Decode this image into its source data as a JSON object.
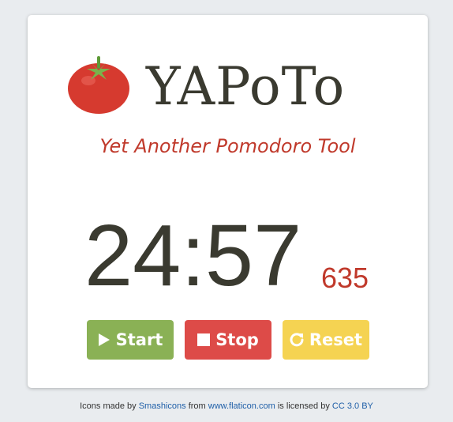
{
  "header": {
    "title": "YAPoTo",
    "subtitle": "Yet Another Pomodoro Tool",
    "logo_icon": "tomato-icon"
  },
  "timer": {
    "time": "24:57",
    "milliseconds": "635"
  },
  "controls": {
    "start_label": "Start",
    "stop_label": "Stop",
    "reset_label": "Reset",
    "start_icon": "play-icon",
    "stop_icon": "stop-icon",
    "reset_icon": "reset-icon"
  },
  "footer": {
    "prefix": "Icons made by",
    "author_link": "Smashicons",
    "from_text": "from",
    "site_link": "www.flaticon.com",
    "license_text": "is licensed by",
    "license_link": "CC 3.0 BY"
  },
  "colors": {
    "background": "#e9ecef",
    "title": "#3a3a30",
    "accent_red": "#c0392b",
    "start": "#8ab155",
    "stop": "#dd4b48",
    "reset": "#f5d352",
    "link": "#1f5fa8"
  }
}
